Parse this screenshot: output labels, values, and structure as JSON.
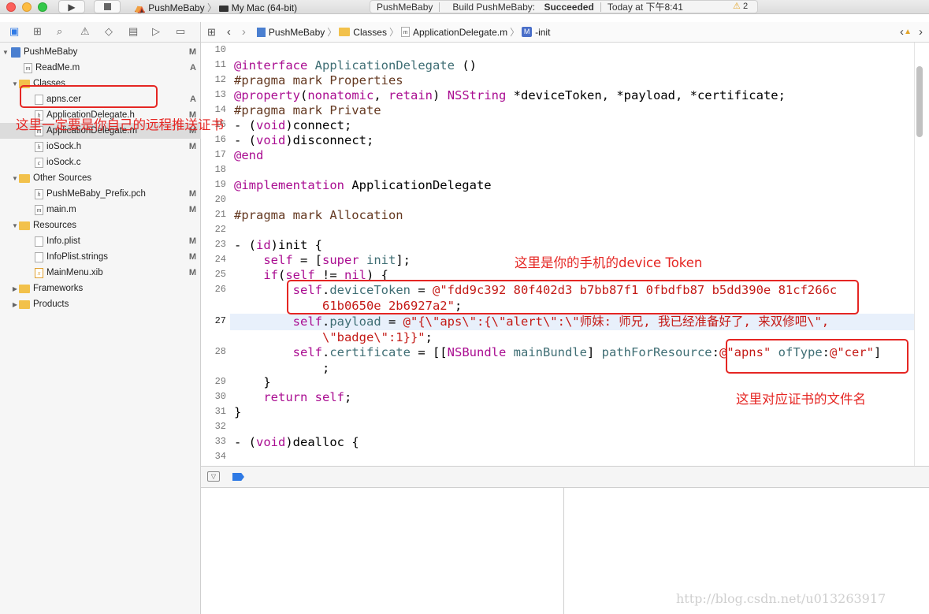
{
  "toolbar": {
    "scheme_project": "PushMeBaby",
    "scheme_target": "My Mac (64-bit)",
    "status_project": "PushMeBaby",
    "status_build": "Build PushMeBaby: ",
    "status_result": "Succeeded",
    "status_time": "Today at 下午8:41",
    "warning_count": "2",
    "run_icon": "play-icon",
    "stop_icon": "stop-icon"
  },
  "navigator": {
    "items": [
      {
        "label": "PushMeBaby",
        "badge": "M"
      },
      {
        "label": "ReadMe.m",
        "badge": "A"
      },
      {
        "label": "Classes",
        "badge": ""
      },
      {
        "label": "apns.cer",
        "badge": "A"
      },
      {
        "label": "ApplicationDelegate.h",
        "badge": "M"
      },
      {
        "label": "ApplicationDelegate.m",
        "badge": "M"
      },
      {
        "label": "ioSock.h",
        "badge": "M"
      },
      {
        "label": "ioSock.c",
        "badge": ""
      },
      {
        "label": "Other Sources",
        "badge": ""
      },
      {
        "label": "PushMeBaby_Prefix.pch",
        "badge": "M"
      },
      {
        "label": "main.m",
        "badge": "M"
      },
      {
        "label": "Resources",
        "badge": ""
      },
      {
        "label": "Info.plist",
        "badge": "M"
      },
      {
        "label": "InfoPlist.strings",
        "badge": "M"
      },
      {
        "label": "MainMenu.xib",
        "badge": "M"
      },
      {
        "label": "Frameworks",
        "badge": ""
      },
      {
        "label": "Products",
        "badge": ""
      }
    ]
  },
  "jumpbar": {
    "project": "PushMeBaby",
    "group": "Classes",
    "file": "ApplicationDelegate.m",
    "symbol": "-init"
  },
  "editor": {
    "line_numbers": [
      "10",
      "11",
      "12",
      "13",
      "14",
      "15",
      "16",
      "17",
      "18",
      "19",
      "20",
      "21",
      "22",
      "23",
      "24",
      "25",
      "26",
      "",
      "27",
      "",
      "28",
      "",
      "29",
      "30",
      "31",
      "32",
      "33",
      "34"
    ]
  },
  "annotations": {
    "cert_note": "这里一定要是你自己的远程推送证书",
    "token_note": "这里是你的手机的device Token",
    "filename_note": "这里对应证书的文件名"
  },
  "watermark": "http://blog.csdn.net/u013263917"
}
